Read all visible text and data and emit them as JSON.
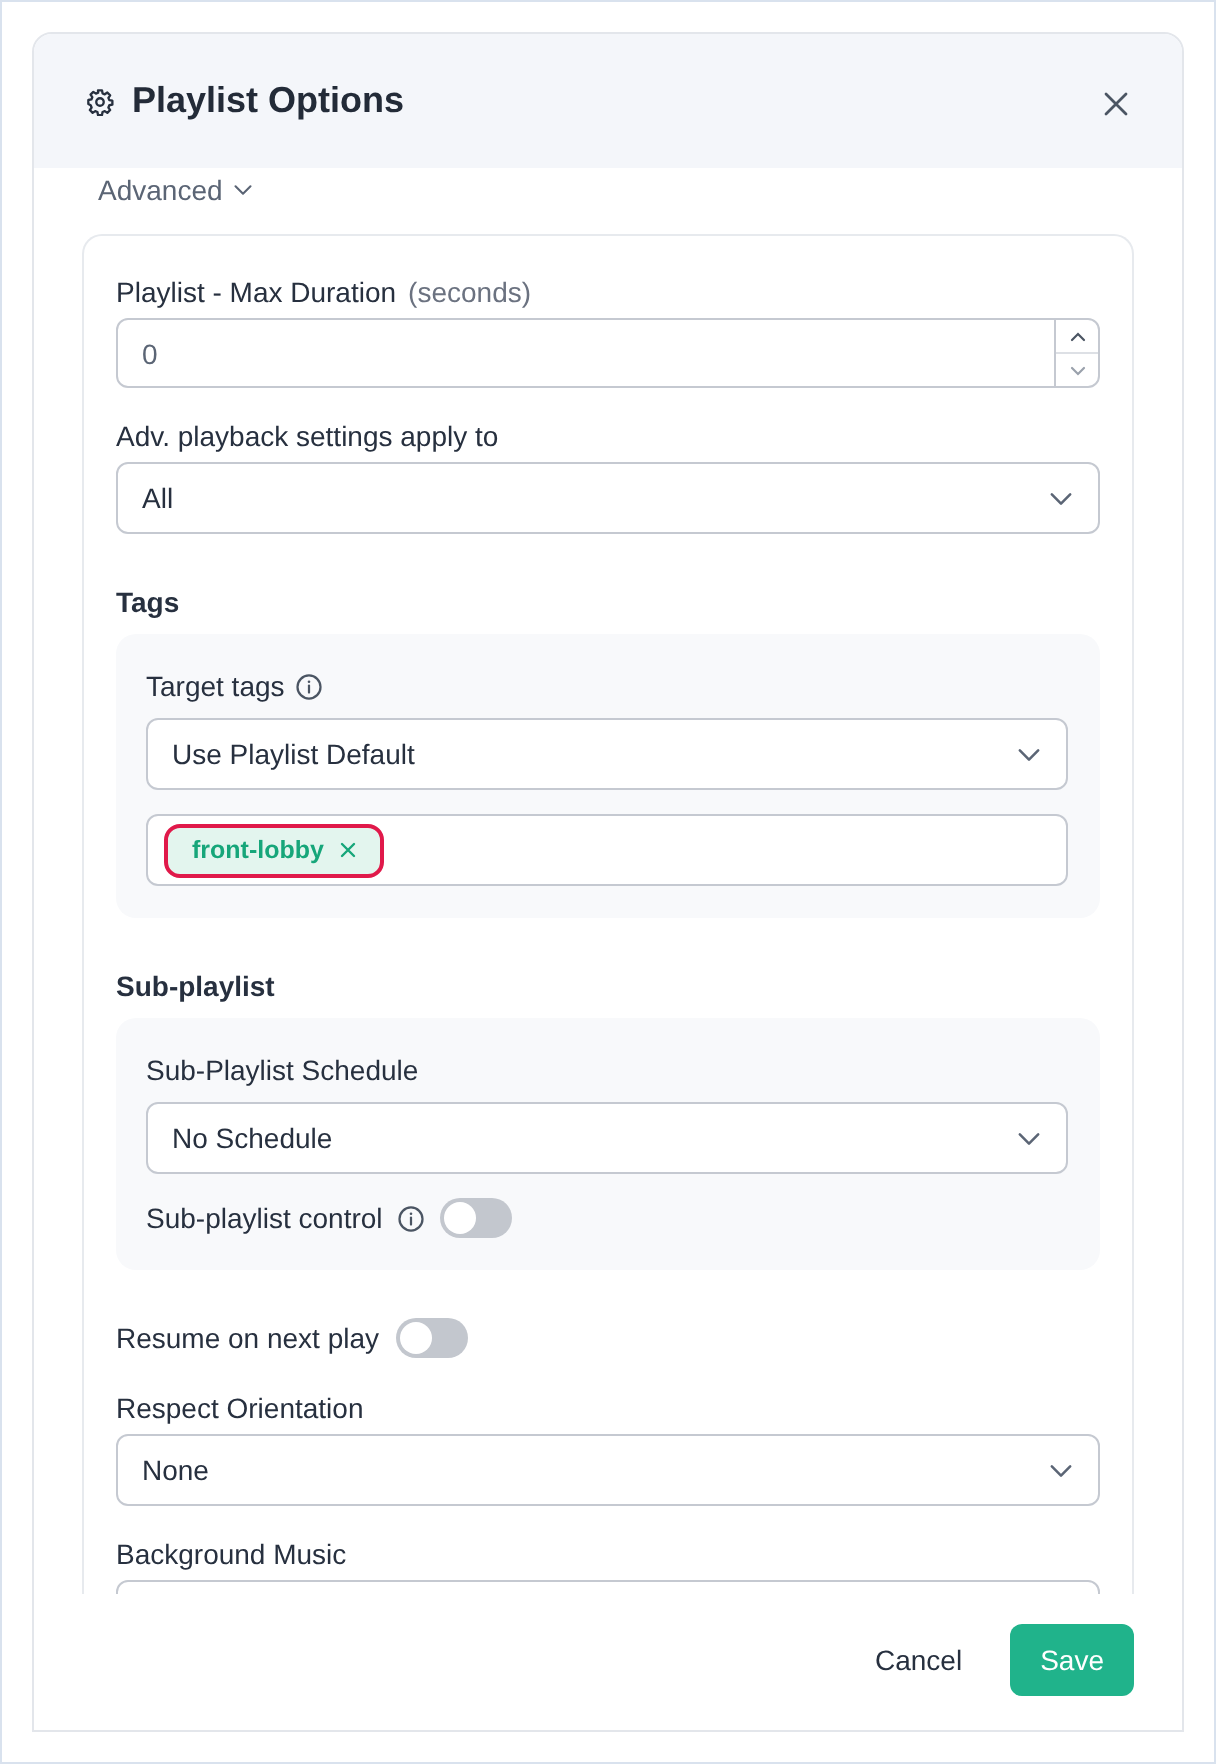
{
  "dialog": {
    "title": "Playlist Options"
  },
  "advanced": {
    "label": "Advanced",
    "expanded": true
  },
  "fields": [
    {
      "kind": "number",
      "label": "Playlist - Max Duration",
      "hint": "(seconds)",
      "value": "0"
    },
    {
      "kind": "select",
      "label": "Adv. playback settings apply to",
      "value": "All"
    },
    {
      "kind": "group",
      "title": "Tags",
      "items": [
        {
          "kind": "select",
          "label": "Target tags",
          "info": true,
          "value": "Use Playlist Default"
        },
        {
          "kind": "tags",
          "tags": [
            {
              "label": "front-lobby",
              "highlighted": true
            }
          ]
        }
      ]
    },
    {
      "kind": "group",
      "title": "Sub-playlist",
      "items": [
        {
          "kind": "select",
          "label": "Sub-Playlist Schedule",
          "value": "No Schedule"
        },
        {
          "kind": "toggle",
          "label": "Sub-playlist control",
          "info": true,
          "on": false
        }
      ]
    },
    {
      "kind": "toggle",
      "label": "Resume on next play",
      "on": false
    },
    {
      "kind": "select",
      "label": "Respect Orientation",
      "value": "None"
    },
    {
      "kind": "select",
      "label": "Background Music"
    }
  ],
  "buttons": [
    {
      "label": "Cancel",
      "kind": "text"
    },
    {
      "label": "Save",
      "kind": "primary"
    }
  ]
}
